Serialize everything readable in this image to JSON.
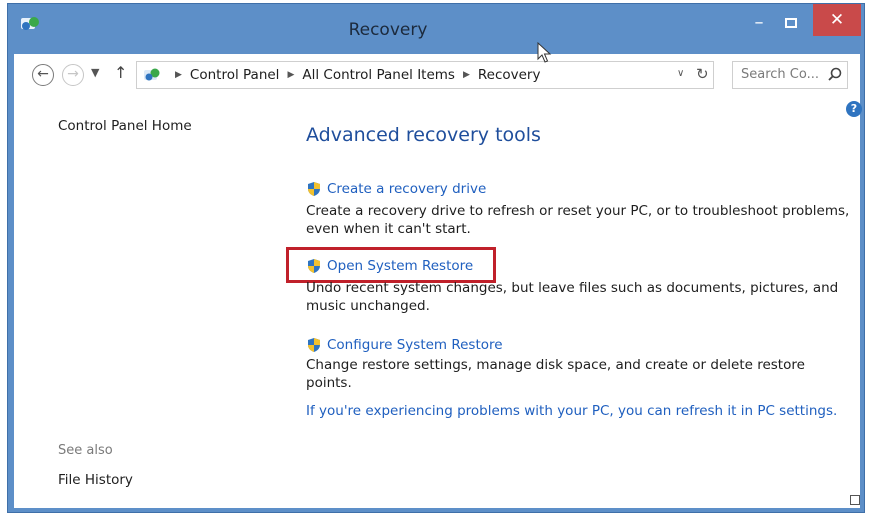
{
  "window": {
    "title": "Recovery"
  },
  "address_bar": {
    "crumbs": [
      "Control Panel",
      "All Control Panel Items",
      "Recovery"
    ]
  },
  "search": {
    "placeholder": "Search Co..."
  },
  "sidebar": {
    "home_link": "Control Panel Home",
    "see_also_heading": "See also",
    "see_also_items": [
      "File History"
    ]
  },
  "main": {
    "heading": "Advanced recovery tools",
    "tools": [
      {
        "label": "Create a recovery drive",
        "description": "Create a recovery drive to refresh or reset your PC, or to troubleshoot problems, even when it can't start."
      },
      {
        "label": "Open System Restore",
        "description": "Undo recent system changes, but leave files such as documents, pictures, and music unchanged."
      },
      {
        "label": "Configure System Restore",
        "description": "Change restore settings, manage disk space, and create or delete restore points."
      }
    ],
    "refresh_link": "If you're experiencing problems with your PC, you can refresh it in PC settings."
  },
  "colors": {
    "link": "#1f5fbf",
    "heading": "#1f4e9c",
    "titlebar": "#5d8fc8",
    "close_button": "#c94a4a",
    "highlight": "#c0202a"
  }
}
